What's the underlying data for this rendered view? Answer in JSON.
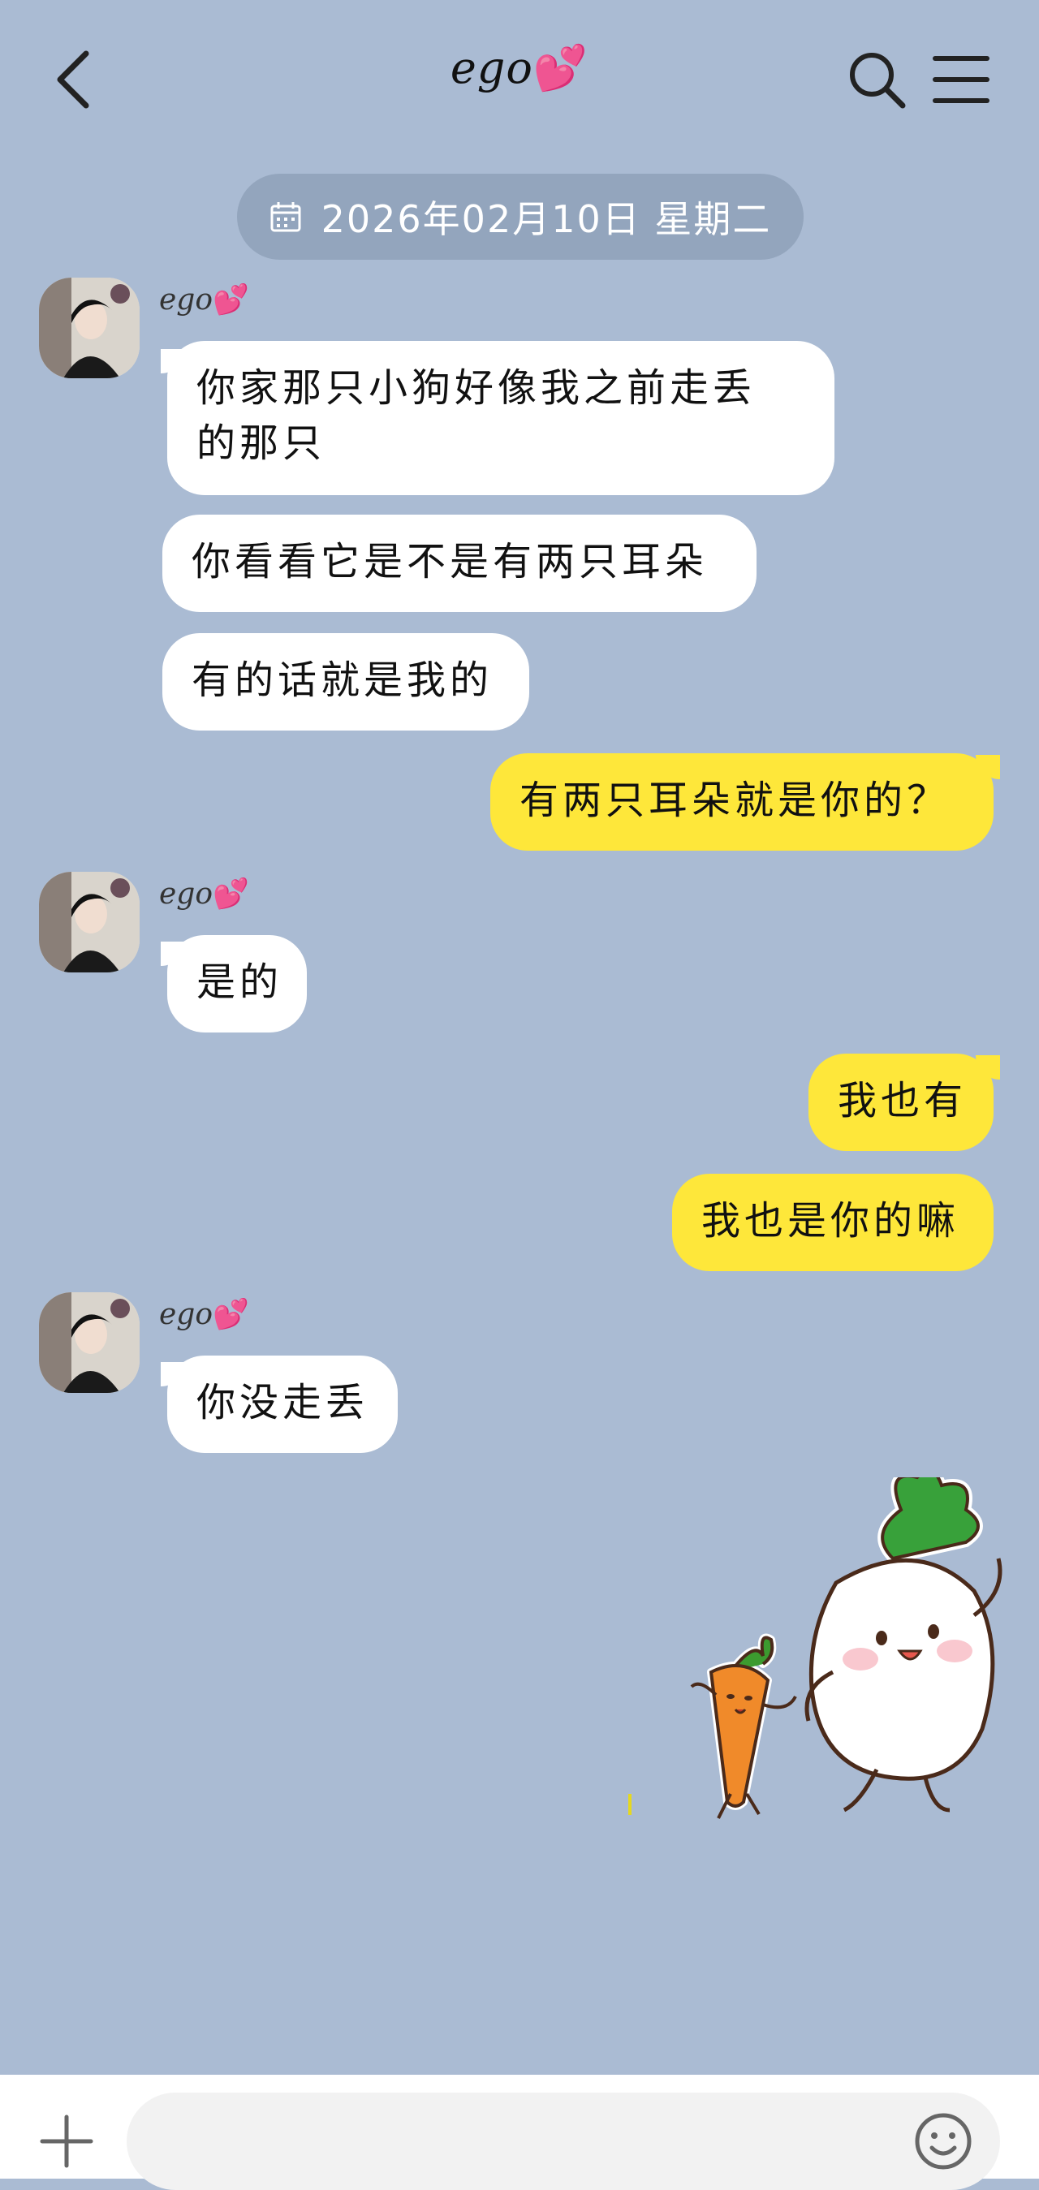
{
  "header": {
    "title": "ego",
    "title_emoji": "💕"
  },
  "date_separator": "2026年02月10日 星期二",
  "contact": {
    "name": "ego",
    "name_emoji": "💕"
  },
  "messages": [
    {
      "side": "in",
      "line1": "你家那只小狗好像我之前走丢",
      "line2": "的那只"
    },
    {
      "side": "in",
      "text": "你看看它是不是有两只耳朵"
    },
    {
      "side": "in",
      "text": "有的话就是我的"
    },
    {
      "side": "out",
      "text": "有两只耳朵就是你的？"
    },
    {
      "side": "in",
      "text": "是的"
    },
    {
      "side": "out",
      "text": "我也有"
    },
    {
      "side": "out",
      "text": "我也是你的嘛"
    },
    {
      "side": "in",
      "text": "你没走丢"
    }
  ],
  "sticker": {
    "icon": "radish-and-carrot-sticker"
  },
  "input": {
    "placeholder": "",
    "value": ""
  },
  "colors": {
    "background": "#aabbd3",
    "incoming_bubble": "#ffffff",
    "outgoing_bubble": "#fee73a",
    "date_pill": "#93a5bd",
    "heart": "#ff4f9c"
  }
}
